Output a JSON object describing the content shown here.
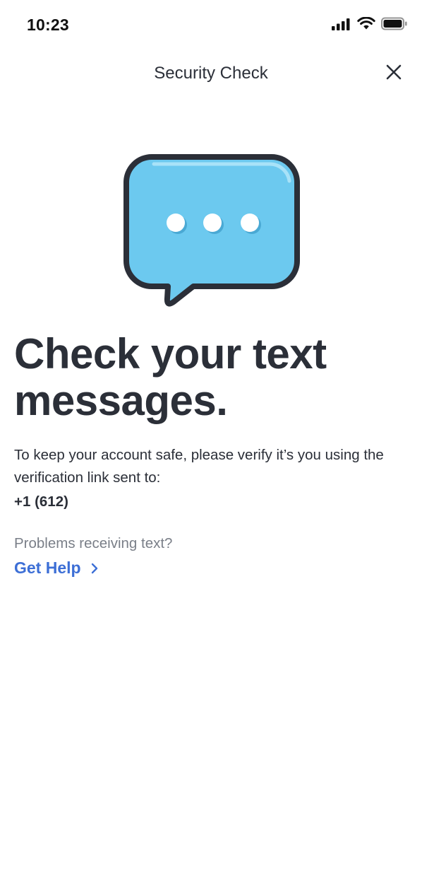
{
  "status_bar": {
    "time": "10:23",
    "icons": [
      "cellular-signal-icon",
      "wifi-icon",
      "battery-icon"
    ]
  },
  "nav": {
    "title": "Security Check",
    "close_icon": "close-icon"
  },
  "hero": {
    "icon": "chat-bubble-typing-icon",
    "bubble_color": "#6cc9ef",
    "outline_color": "#2b2f38"
  },
  "main": {
    "headline": "Check your text messages.",
    "body": "To keep your account safe, please verify it’s you using the verification link sent to:",
    "phone": "+1 (612)",
    "help_prompt": "Problems receiving text?",
    "help_link": "Get Help",
    "help_link_icon": "chevron-right-icon"
  },
  "colors": {
    "text": "#2b2f38",
    "muted": "#7a7f88",
    "link": "#3d6fd6"
  }
}
